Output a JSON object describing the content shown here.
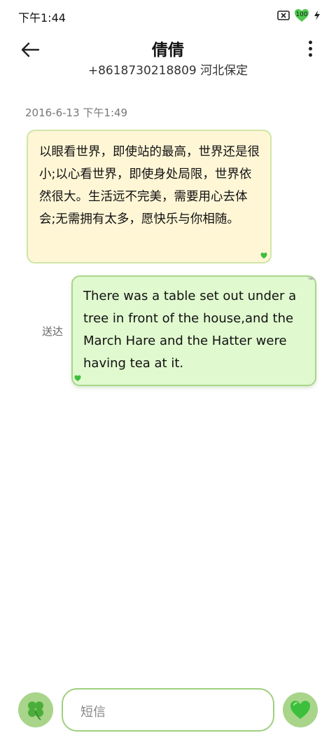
{
  "status_bar": {
    "time": "下午1:44",
    "battery_level": "100",
    "icons": [
      "screen-record-icon",
      "battery-heart-icon",
      "charging-icon"
    ]
  },
  "header": {
    "title": "倩倩",
    "subtitle": "+8618730218809 河北保定"
  },
  "conversation": {
    "date": "2016-6-13 下午1:49",
    "received_message": "以眼看世界，即使站的最高，世界还是很小;以心看世界，即使身处局限，世界依然很大。生活远不完美，需要用心去体会;无需拥有太多，愿快乐与你相随。",
    "sent_message": "There was a table set out under a tree in front of the house,and the March Hare and the Hatter were having tea at it.",
    "sent_status": "送达"
  },
  "composer": {
    "placeholder": "短信"
  },
  "colors": {
    "received_bubble": "#fff6d6",
    "sent_bubble": "#e0f9cf",
    "accent_green": "#a8d58a",
    "heart_green": "#3cbf3c"
  }
}
